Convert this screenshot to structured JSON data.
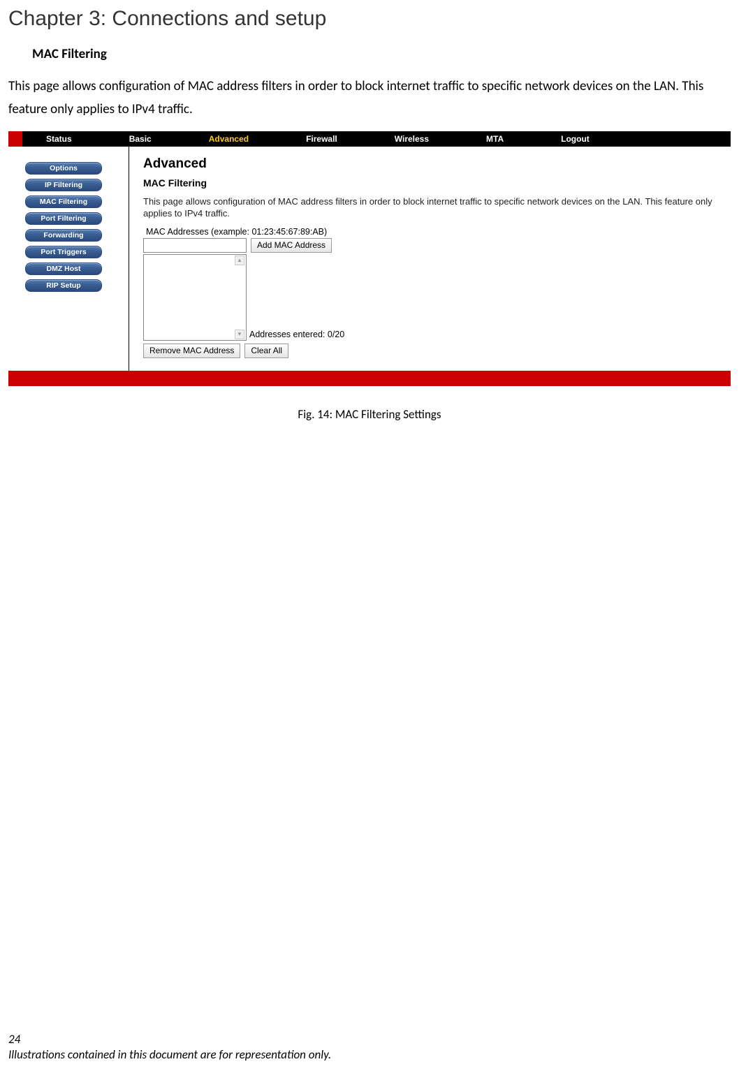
{
  "chapter_title": "Chapter 3: Connections and setup",
  "section_title": "MAC Filtering",
  "body_text": "This page allows configuration of MAC address filters in order to block internet traffic to specific network devices on the LAN. This feature only applies to IPv4 traffic.",
  "router": {
    "topnav": [
      "Status",
      "Basic",
      "Advanced",
      "Firewall",
      "Wireless",
      "MTA",
      "Logout"
    ],
    "topnav_active": "Advanced",
    "sidenav": [
      "Options",
      "IP Filtering",
      "MAC Filtering",
      "Port Filtering",
      "Forwarding",
      "Port Triggers",
      "DMZ Host",
      "RIP Setup"
    ],
    "main": {
      "heading": "Advanced",
      "subheading": "MAC Filtering",
      "desc": "This page allows configuration of MAC address filters in order to block internet traffic to specific network devices on the LAN. This feature only applies to IPv4 traffic.",
      "mac_label": "MAC Addresses (example: 01:23:45:67:89:AB)",
      "add_btn": "Add MAC Address",
      "entered": "Addresses entered: 0/20",
      "remove_btn": "Remove MAC Address",
      "clearall_btn": "Clear All"
    }
  },
  "figure_caption": "Fig. 14: MAC Filtering Settings",
  "page_number": "24",
  "footer_note": "Illustrations contained in this document are for representation only."
}
